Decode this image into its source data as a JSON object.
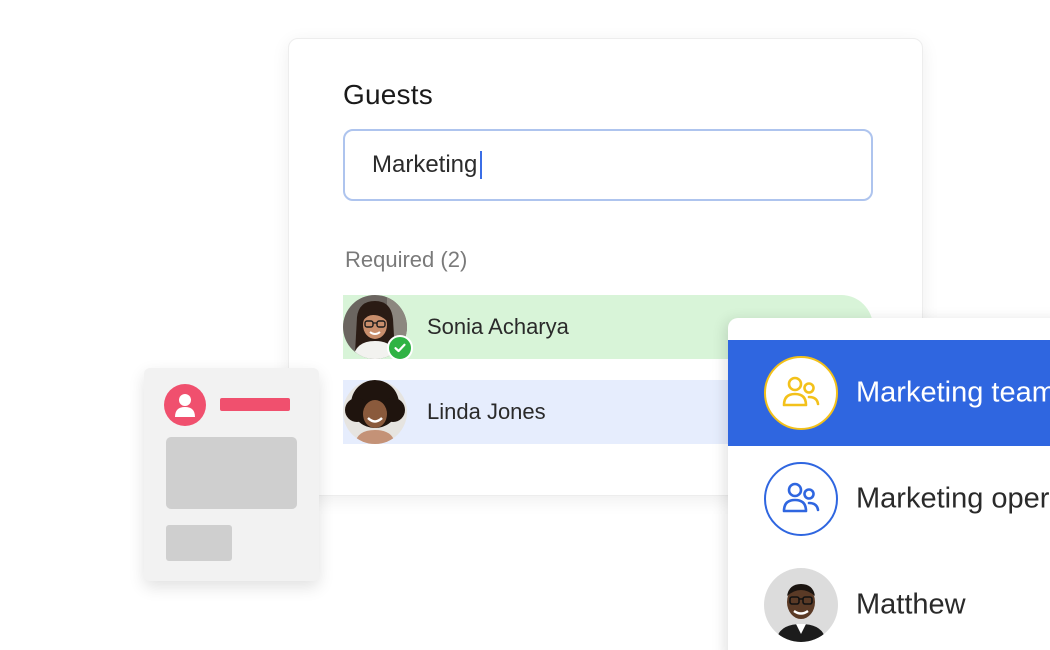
{
  "guests": {
    "title": "Guests",
    "search_value": "Marketing",
    "section_label": "Required (2)",
    "people": [
      {
        "name": "Sonia Acharya",
        "status": "accepted",
        "highlight": "#d8f4d8"
      },
      {
        "name": "Linda Jones",
        "status": "pending",
        "highlight": "#e6edfd"
      }
    ]
  },
  "dropdown": {
    "items": [
      {
        "label": "Marketing team",
        "type": "group",
        "icon": "group-icon",
        "selected": true,
        "icon_color": "#f3c11a"
      },
      {
        "label": "Marketing operations",
        "type": "group",
        "icon": "group-icon",
        "selected": false,
        "icon_color": "#2f66e0"
      },
      {
        "label": "Matthew",
        "type": "person",
        "icon": "avatar",
        "selected": false
      }
    ]
  },
  "colors": {
    "accent": "#2f66e0",
    "success": "#2fb344",
    "placeholder_accent": "#f0506e"
  }
}
